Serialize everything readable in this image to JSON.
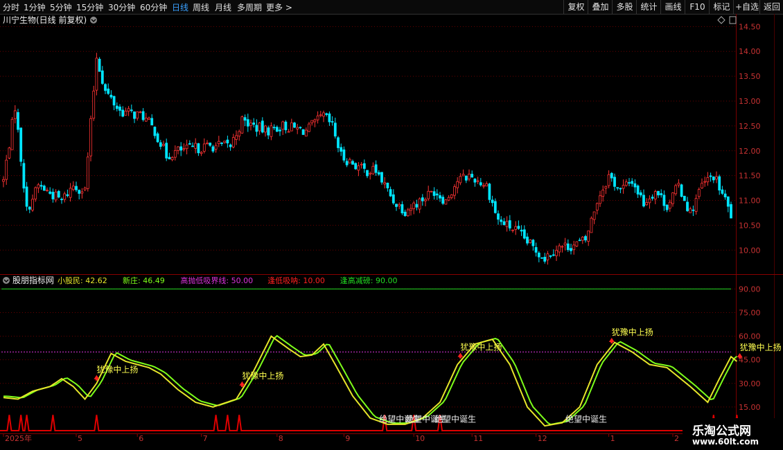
{
  "toolbar": {
    "periods": [
      "分时",
      "1分钟",
      "5分钟",
      "15分钟",
      "30分钟",
      "60分钟",
      "日线",
      "周线",
      "月线",
      "多周期",
      "更多 >"
    ],
    "active_period": "日线",
    "right_buttons": [
      "复权",
      "叠加",
      "多股",
      "统计",
      "画线",
      "F10",
      "标记",
      "+自选",
      "返回"
    ]
  },
  "colors": {
    "up": "#ff3333",
    "down": "#00e5ff",
    "grid": "#6b0000",
    "axis_text": "#c83232",
    "line_small": "#e6e62a",
    "line_new": "#7dff1a",
    "high_line": "#dd33dd",
    "low_line": "#ff2020",
    "top_line": "#22dd22",
    "signal": "#ffff50",
    "label": "#f0f0f0"
  },
  "chart_data": [
    {
      "type": "candlestick",
      "title": "川宁生物(日线 前复权)",
      "yticks": [
        "14.50",
        "14.00",
        "13.50",
        "13.00",
        "12.50",
        "12.00",
        "11.50",
        "11.00",
        "10.50",
        "10.00"
      ],
      "ylim": [
        9.6,
        14.7
      ],
      "grid": true,
      "close_path": [
        [
          0,
          11.4
        ],
        [
          4,
          12.9
        ],
        [
          8,
          10.8
        ],
        [
          12,
          11.3
        ],
        [
          20,
          11.0
        ],
        [
          24,
          11.3
        ],
        [
          28,
          11.2
        ],
        [
          32,
          13.9
        ],
        [
          35,
          13.2
        ],
        [
          40,
          12.8
        ],
        [
          48,
          12.7
        ],
        [
          52,
          12.4
        ],
        [
          56,
          11.9
        ],
        [
          60,
          12.0
        ],
        [
          72,
          12.1
        ],
        [
          78,
          12.1
        ],
        [
          82,
          12.6
        ],
        [
          90,
          12.4
        ],
        [
          96,
          12.5
        ],
        [
          104,
          12.4
        ],
        [
          110,
          12.7
        ],
        [
          113,
          12.5
        ],
        [
          116,
          11.9
        ],
        [
          124,
          11.6
        ],
        [
          128,
          11.6
        ],
        [
          134,
          11.0
        ],
        [
          138,
          10.8
        ],
        [
          142,
          10.95
        ],
        [
          148,
          11.2
        ],
        [
          152,
          11.0
        ],
        [
          156,
          11.4
        ],
        [
          160,
          11.5
        ],
        [
          166,
          11.3
        ],
        [
          170,
          10.6
        ],
        [
          176,
          10.4
        ],
        [
          182,
          10.05
        ],
        [
          186,
          9.85
        ],
        [
          190,
          10.05
        ],
        [
          196,
          10.1
        ],
        [
          200,
          10.2
        ],
        [
          204,
          11.0
        ],
        [
          208,
          11.5
        ],
        [
          212,
          11.2
        ],
        [
          216,
          11.4
        ],
        [
          220,
          10.95
        ],
        [
          224,
          11.2
        ],
        [
          228,
          10.9
        ],
        [
          232,
          11.3
        ],
        [
          236,
          10.75
        ],
        [
          240,
          11.3
        ],
        [
          244,
          11.5
        ],
        [
          248,
          11.0
        ],
        [
          250,
          10.7
        ]
      ],
      "n_bars": 251
    },
    {
      "type": "line",
      "title": "股朋指标网",
      "legend": [
        {
          "name": "小股民:",
          "value": "42.62"
        },
        {
          "name": "新庄:",
          "value": "46.49"
        },
        {
          "name": "高抛低吸界线:",
          "value": "50.00"
        },
        {
          "name": "逢低吸呐:",
          "value": "10.00"
        },
        {
          "name": "逢高减磅:",
          "value": "90.00"
        }
      ],
      "yticks": [
        "90.00",
        "75.00",
        "60.00",
        "45.00",
        "30.00",
        "15.00"
      ],
      "ylim": [
        0,
        95
      ],
      "hlines": {
        "high_low": 50,
        "top": 90
      },
      "series_path": [
        [
          0,
          21
        ],
        [
          5,
          20
        ],
        [
          10,
          25
        ],
        [
          16,
          28
        ],
        [
          20,
          33
        ],
        [
          24,
          28
        ],
        [
          28,
          20
        ],
        [
          32,
          30
        ],
        [
          37,
          49
        ],
        [
          42,
          44
        ],
        [
          50,
          40
        ],
        [
          54,
          36
        ],
        [
          60,
          26
        ],
        [
          66,
          18
        ],
        [
          72,
          15
        ],
        [
          80,
          20
        ],
        [
          86,
          38
        ],
        [
          92,
          60
        ],
        [
          98,
          52
        ],
        [
          102,
          47
        ],
        [
          106,
          48
        ],
        [
          110,
          55
        ],
        [
          114,
          42
        ],
        [
          120,
          22
        ],
        [
          126,
          8
        ],
        [
          132,
          4
        ],
        [
          138,
          4
        ],
        [
          144,
          8
        ],
        [
          150,
          18
        ],
        [
          156,
          42
        ],
        [
          162,
          55
        ],
        [
          168,
          58
        ],
        [
          174,
          42
        ],
        [
          180,
          15
        ],
        [
          186,
          3
        ],
        [
          192,
          5
        ],
        [
          198,
          15
        ],
        [
          204,
          42
        ],
        [
          210,
          56
        ],
        [
          216,
          50
        ],
        [
          222,
          42
        ],
        [
          228,
          40
        ],
        [
          236,
          28
        ],
        [
          242,
          18
        ],
        [
          246,
          33
        ],
        [
          250,
          47
        ],
        [
          252,
          44
        ]
      ],
      "spikes_x": [
        2,
        6,
        8,
        17,
        32,
        73,
        77,
        81,
        131,
        141,
        150,
        244,
        252
      ],
      "signals": [
        {
          "x": 32,
          "text": "犹豫中上扬"
        },
        {
          "x": 82,
          "text": "犹豫中上扬"
        },
        {
          "x": 157,
          "text": "犹豫中上扬"
        },
        {
          "x": 209,
          "text": "犹豫中上扬"
        },
        {
          "x": 253,
          "text": "犹豫中上扬"
        }
      ],
      "birth_labels": [
        {
          "x": 131,
          "text": "绝望中诞生"
        },
        {
          "x": 140,
          "text": "绝望中诞生"
        },
        {
          "x": 150,
          "text": "绝望中诞生"
        },
        {
          "x": 195,
          "text": "绝望中诞生"
        }
      ],
      "xticks": [
        {
          "x": 0,
          "text": "2025年"
        },
        {
          "x": 25,
          "text": "5"
        },
        {
          "x": 46,
          "text": "6"
        },
        {
          "x": 68,
          "text": "7"
        },
        {
          "x": 94,
          "text": "8"
        },
        {
          "x": 117,
          "text": "9"
        },
        {
          "x": 141,
          "text": "10"
        },
        {
          "x": 161,
          "text": "11"
        },
        {
          "x": 183,
          "text": "12"
        },
        {
          "x": 208,
          "text": "1"
        },
        {
          "x": 230,
          "text": "2"
        }
      ]
    }
  ],
  "watermark": {
    "name": "乐淘公式网",
    "url": "www.60lt.com"
  }
}
